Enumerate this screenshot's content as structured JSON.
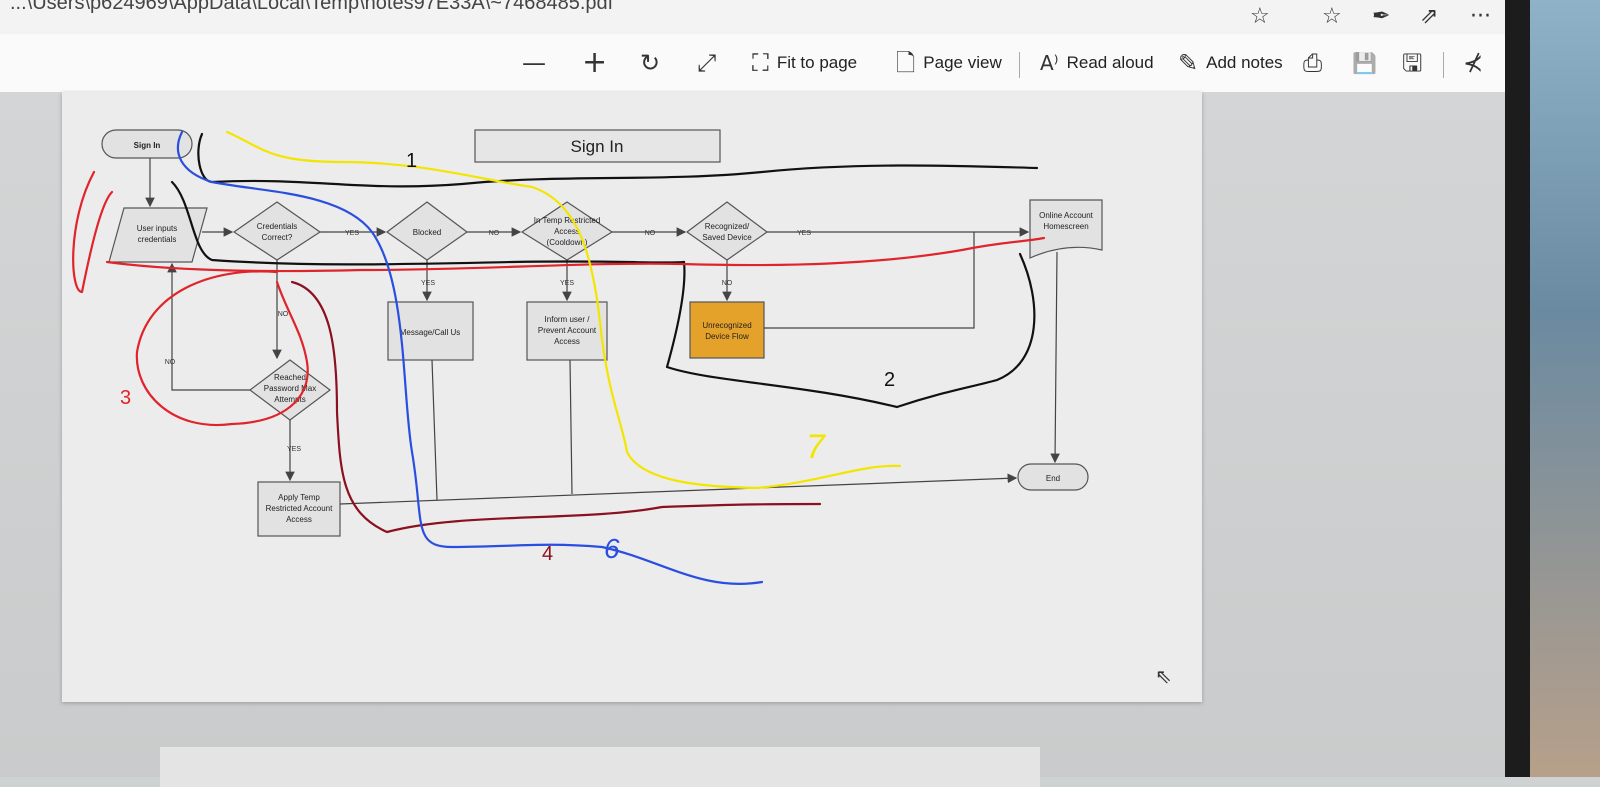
{
  "address_bar": {
    "url": "...\\Users\\p624969\\AppData\\Local\\Temp\\notes97E33A\\~7468485.pdf",
    "favorite_icon": "star-icon",
    "favorites_bar_icon": "favorites-list-icon",
    "pen_icon": "pen-icon",
    "share_icon": "share-icon",
    "more_icon": "ellipsis-icon",
    "more_label": "···"
  },
  "toolbar": {
    "zoom_out_icon": "minus-icon",
    "zoom_out": "—",
    "zoom_in_icon": "plus-icon",
    "zoom_in": "+",
    "rotate_icon": "rotate-icon",
    "rotate": "↻",
    "fullscreen_icon": "expand-icon",
    "fullscreen": "⤢",
    "fit_to_page": "Fit to page",
    "fit_glyph": "⛶",
    "page_view": "Page view",
    "page_view_glyph": "🗋",
    "read_aloud": "Read aloud",
    "read_aloud_glyph": "A⁾",
    "add_notes": "Add notes",
    "add_notes_glyph": "✎",
    "print_glyph": "⎙",
    "save_glyph": "💾",
    "save_as_glyph": "🖫",
    "pin_glyph": "⊀"
  },
  "flowchart": {
    "title": "Sign In",
    "nodes": {
      "start": "Sign In",
      "user_inputs": [
        "User inputs",
        "credentials"
      ],
      "credentials_correct": [
        "Credentials",
        "Correct?"
      ],
      "blocked": "Blocked",
      "temp_restricted": [
        "In Temp Restricted",
        "Access",
        "(Cooldown)"
      ],
      "recognized": [
        "Recognized/",
        "Saved Device"
      ],
      "online_account": [
        "Online Account",
        "Homescreen"
      ],
      "message_call": "Message/Call Us",
      "inform_user": [
        "Inform user /",
        "Prevent Account",
        "Access"
      ],
      "unrecognized": [
        "Unrecognized",
        "Device Flow"
      ],
      "reached_max": [
        "Reached",
        "Password Max",
        "Attempts"
      ],
      "apply_temp": [
        "Apply Temp",
        "Restricted Account",
        "Access"
      ],
      "end": "End"
    },
    "edge_labels": {
      "yes": "YES",
      "no": "NO"
    }
  },
  "annotations": [
    {
      "label": "1",
      "color": "#111111"
    },
    {
      "label": "2",
      "color": "#111111"
    },
    {
      "label": "3",
      "color": "#e0242b"
    },
    {
      "label": "4",
      "color": "#8b1020"
    },
    {
      "label": "6",
      "color": "#2a4ee0"
    },
    {
      "label": "7",
      "color": "#f2e600"
    }
  ],
  "colors": {
    "unrecognized_fill": "#e5a22a",
    "chart_stroke": "#555555"
  }
}
